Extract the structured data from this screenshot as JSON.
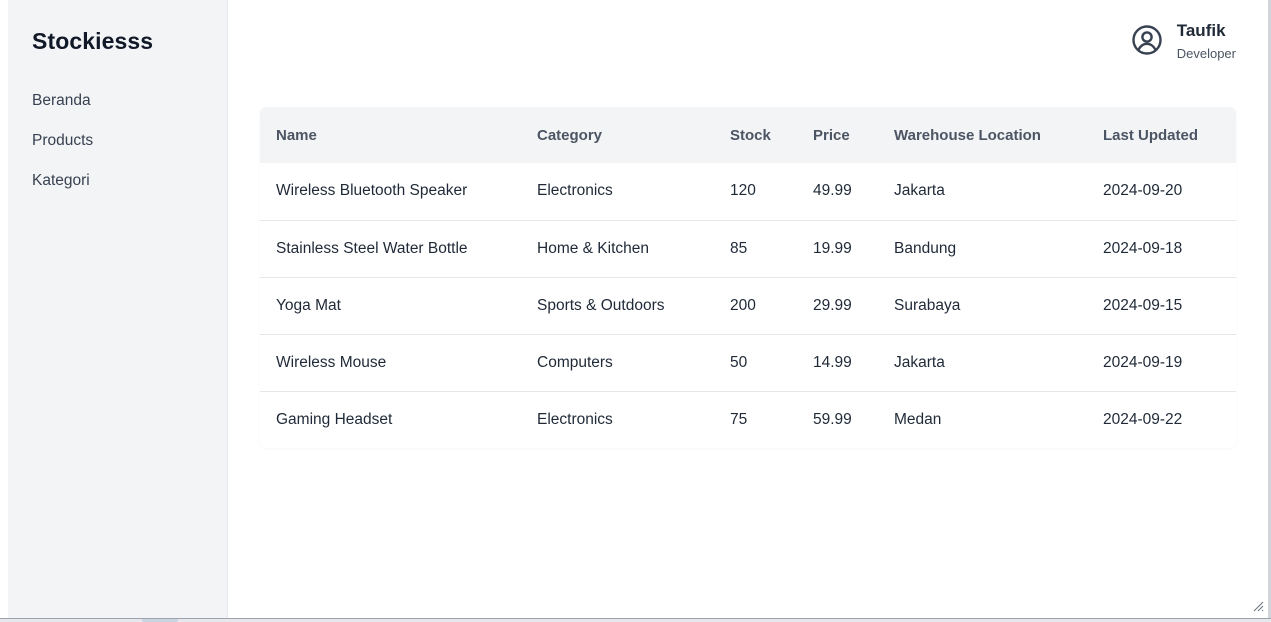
{
  "app": {
    "brand": "Stockiesss",
    "nav": [
      {
        "label": "Beranda"
      },
      {
        "label": "Products"
      },
      {
        "label": "Kategori"
      }
    ]
  },
  "user": {
    "name": "Taufik",
    "role": "Developer",
    "icon": "user-circle-icon"
  },
  "table": {
    "columns": [
      "Name",
      "Category",
      "Stock",
      "Price",
      "Warehouse Location",
      "Last Updated"
    ],
    "rows": [
      [
        "Wireless Bluetooth Speaker",
        "Electronics",
        "120",
        "49.99",
        "Jakarta",
        "2024-09-20"
      ],
      [
        "Stainless Steel Water Bottle",
        "Home & Kitchen",
        "85",
        "19.99",
        "Bandung",
        "2024-09-18"
      ],
      [
        "Yoga Mat",
        "Sports & Outdoors",
        "200",
        "29.99",
        "Surabaya",
        "2024-09-15"
      ],
      [
        "Wireless Mouse",
        "Computers",
        "50",
        "14.99",
        "Jakarta",
        "2024-09-19"
      ],
      [
        "Gaming Headset",
        "Electronics",
        "75",
        "59.99",
        "Medan",
        "2024-09-22"
      ]
    ]
  },
  "colors": {
    "sidebar_bg": "#f3f4f6",
    "header_bg": "#f3f4f6",
    "text": "#1f2937",
    "muted": "#4b5563"
  }
}
